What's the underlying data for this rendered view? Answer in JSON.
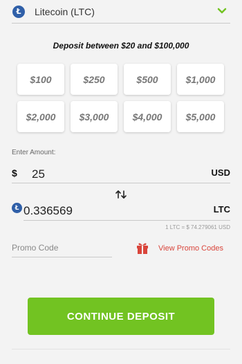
{
  "currency": {
    "name": "Litecoin (LTC)",
    "icon": "litecoin-icon",
    "icon_glyph": "Ł"
  },
  "deposit_range": "Deposit between $20 and $100,000",
  "presets": [
    "$100",
    "$250",
    "$500",
    "$1,000",
    "$2,000",
    "$3,000",
    "$4,000",
    "$5,000"
  ],
  "amount": {
    "label": "Enter Amount:",
    "symbol": "$",
    "value": "25",
    "code": "USD"
  },
  "crypto": {
    "value": "0.336569",
    "code": "LTC"
  },
  "rate": "1 LTC = $ 74.279061 USD",
  "promo": {
    "placeholder": "Promo Code",
    "link": "View Promo Codes"
  },
  "continue_label": "CONTINUE DEPOSIT",
  "colors": {
    "accent": "#72c322",
    "link": "#d9453b",
    "coin": "#2f5fa8"
  }
}
